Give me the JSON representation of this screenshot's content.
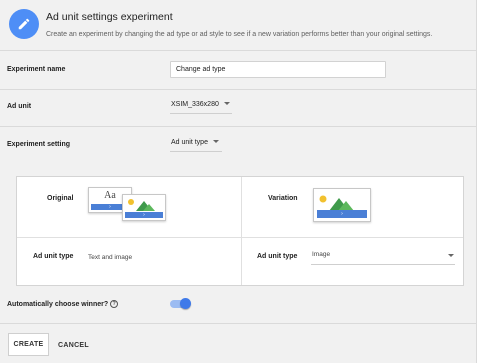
{
  "header": {
    "title": "Ad unit settings experiment",
    "subtitle": "Create an experiment by changing the ad type or ad style to see if a new variation performs better than your original settings.",
    "icon": "pencil-icon"
  },
  "fields": {
    "experiment_name_label": "Experiment name",
    "experiment_name_value": "Change ad type",
    "ad_unit_label": "Ad unit",
    "ad_unit_value": "XSIM_336x280",
    "experiment_setting_label": "Experiment setting",
    "experiment_setting_value": "Ad unit type"
  },
  "comparison": {
    "original_label": "Original",
    "variation_label": "Variation",
    "original_thumb_text": "Aa",
    "original_ad_unit_type_label": "Ad unit type",
    "original_ad_unit_type_value": "Text and image",
    "variation_ad_unit_type_label": "Ad unit type",
    "variation_ad_unit_type_value": "Image"
  },
  "winner": {
    "label": "Automatically choose winner?",
    "help_glyph": "?",
    "enabled": true
  },
  "actions": {
    "create": "CREATE",
    "cancel": "CANCEL"
  },
  "colors": {
    "accent": "#4e8ef6",
    "toggle_on": "#3f7ae9",
    "ad_bar": "#4a7fd6",
    "sun": "#f2c12e",
    "mountain": "#3f9a4b"
  }
}
